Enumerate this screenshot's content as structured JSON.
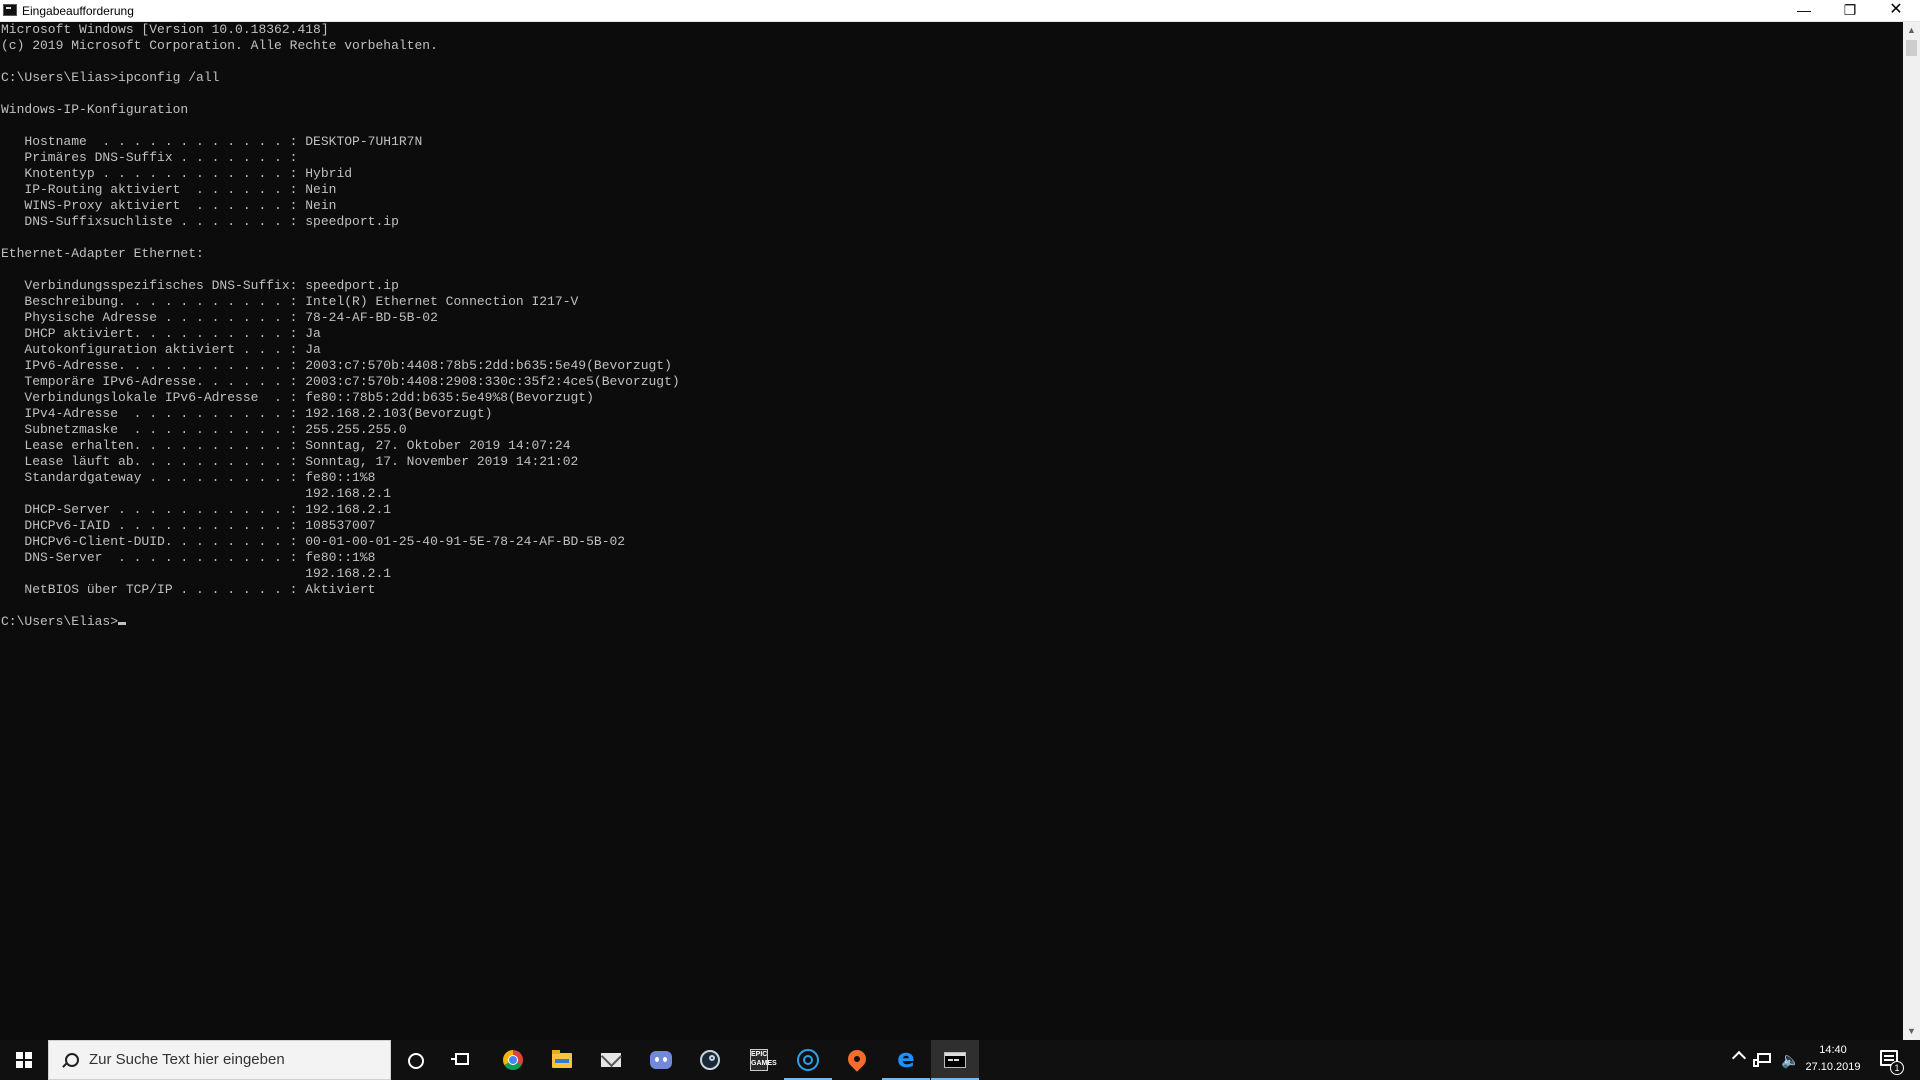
{
  "window": {
    "title": "Eingabeaufforderung",
    "minimize_icon": "minimize-icon",
    "maximize_icon": "restore-icon",
    "close_icon": "close-icon",
    "min_glyph": "—",
    "max_glyph": "❐",
    "close_glyph": "✕"
  },
  "console": {
    "lines": [
      "Microsoft Windows [Version 10.0.18362.418]",
      "(c) 2019 Microsoft Corporation. Alle Rechte vorbehalten.",
      "",
      "C:\\Users\\Elias>ipconfig /all",
      "",
      "Windows-IP-Konfiguration",
      "",
      "   Hostname  . . . . . . . . . . . . : DESKTOP-7UH1R7N",
      "   Primäres DNS-Suffix . . . . . . . :",
      "   Knotentyp . . . . . . . . . . . . : Hybrid",
      "   IP-Routing aktiviert  . . . . . . : Nein",
      "   WINS-Proxy aktiviert  . . . . . . : Nein",
      "   DNS-Suffixsuchliste . . . . . . . : speedport.ip",
      "",
      "Ethernet-Adapter Ethernet:",
      "",
      "   Verbindungsspezifisches DNS-Suffix: speedport.ip",
      "   Beschreibung. . . . . . . . . . . : Intel(R) Ethernet Connection I217-V",
      "   Physische Adresse . . . . . . . . : 78-24-AF-BD-5B-02",
      "   DHCP aktiviert. . . . . . . . . . : Ja",
      "   Autokonfiguration aktiviert . . . : Ja",
      "   IPv6-Adresse. . . . . . . . . . . : 2003:c7:570b:4408:78b5:2dd:b635:5e49(Bevorzugt)",
      "   Temporäre IPv6-Adresse. . . . . . : 2003:c7:570b:4408:2908:330c:35f2:4ce5(Bevorzugt)",
      "   Verbindungslokale IPv6-Adresse  . : fe80::78b5:2dd:b635:5e49%8(Bevorzugt)",
      "   IPv4-Adresse  . . . . . . . . . . : 192.168.2.103(Bevorzugt)",
      "   Subnetzmaske  . . . . . . . . . . : 255.255.255.0",
      "   Lease erhalten. . . . . . . . . . : Sonntag, 27. Oktober 2019 14:07:24",
      "   Lease läuft ab. . . . . . . . . . : Sonntag, 17. November 2019 14:21:02",
      "   Standardgateway . . . . . . . . . : fe80::1%8",
      "                                       192.168.2.1",
      "   DHCP-Server . . . . . . . . . . . : 192.168.2.1",
      "   DHCPv6-IAID . . . . . . . . . . . : 108537007",
      "   DHCPv6-Client-DUID. . . . . . . . : 00-01-00-01-25-40-91-5E-78-24-AF-BD-5B-02",
      "   DNS-Server  . . . . . . . . . . . : fe80::1%8",
      "                                       192.168.2.1",
      "   NetBIOS über TCP/IP . . . . . . . : Aktiviert",
      ""
    ],
    "prompt": "C:\\Users\\Elias>",
    "text_color": "#c0c0c0",
    "background": "#0c0c0c"
  },
  "scrollbar": {
    "up_glyph": "▲",
    "down_glyph": "▼"
  },
  "taskbar": {
    "search_placeholder": "Zur Suche Text hier eingeben",
    "epic_label": "EPIC\nGAMES",
    "edge_glyph": "e",
    "volume_glyph": "🔈",
    "time": "14:40",
    "date": "27.10.2019",
    "notification_count": "1",
    "pinned": [
      "cortana-icon",
      "task-view-icon",
      "chrome-icon",
      "file-explorer-icon",
      "mail-icon",
      "discord-icon",
      "steam-icon",
      "epic-games-icon",
      "uplay-icon",
      "origin-icon",
      "edge-icon",
      "command-prompt-icon"
    ],
    "accent": "#76b9ed"
  }
}
